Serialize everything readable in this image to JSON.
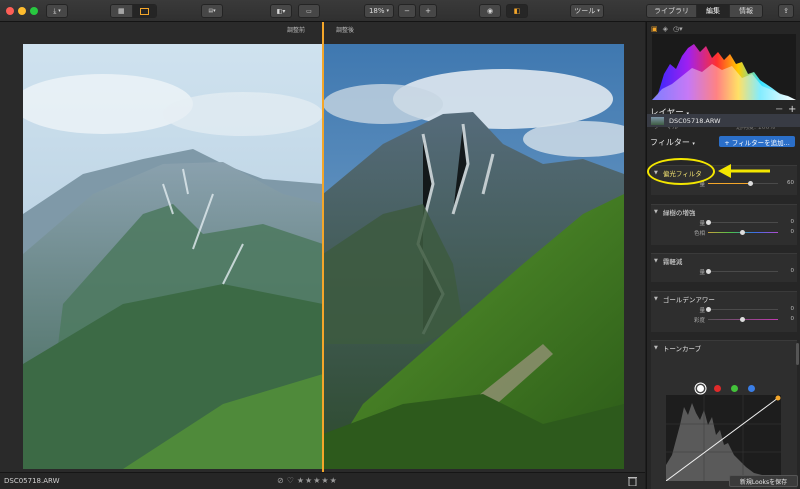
{
  "toolbar": {
    "zoom": "18%",
    "minus": "−",
    "plus": "+",
    "tools_label": "ツール",
    "modes": [
      "ライブラリ",
      "編集",
      "情報"
    ]
  },
  "canvas": {
    "before_label": "調整前",
    "after_label": "調整後",
    "compare_split": 0.5
  },
  "bottom": {
    "filename": "DSC05718.ARW",
    "stars": "★★★★★"
  },
  "panel": {
    "layers_title": "レイヤー",
    "blend_mode": "ノーマル",
    "opacity": "透明度: 100%",
    "layer_name": "DSC05718.ARW",
    "filters_title": "フィルター",
    "add_filter": "+ フィルターを追加...",
    "filters": [
      {
        "name": "偏光フィルタ",
        "sliders": [
          {
            "label": "量",
            "value": "60",
            "fraction": 0.6
          }
        ]
      },
      {
        "name": "緑樹の増強",
        "sliders": [
          {
            "label": "量",
            "value": "0",
            "fraction": 0.0
          },
          {
            "label": "色相",
            "value": "0",
            "fraction": 0.5
          }
        ]
      },
      {
        "name": "霧軽減",
        "sliders": [
          {
            "label": "量",
            "value": "0",
            "fraction": 0.0
          }
        ]
      },
      {
        "name": "ゴールデンアワー",
        "sliders": [
          {
            "label": "量",
            "value": "0",
            "fraction": 0.0
          },
          {
            "label": "彩度",
            "value": "0",
            "fraction": 0.5
          }
        ]
      }
    ],
    "tone_curve_title": "トーンカーブ",
    "curve_channels": [
      "#ffffff",
      "#e02a2a",
      "#43c23a",
      "#3a7ee6"
    ],
    "save_looks": "新規Looksを保存"
  },
  "colors": {
    "accent_orange": "#f4a62a",
    "annotation_yellow": "#f3e600",
    "button_blue": "#2b6fc9"
  }
}
